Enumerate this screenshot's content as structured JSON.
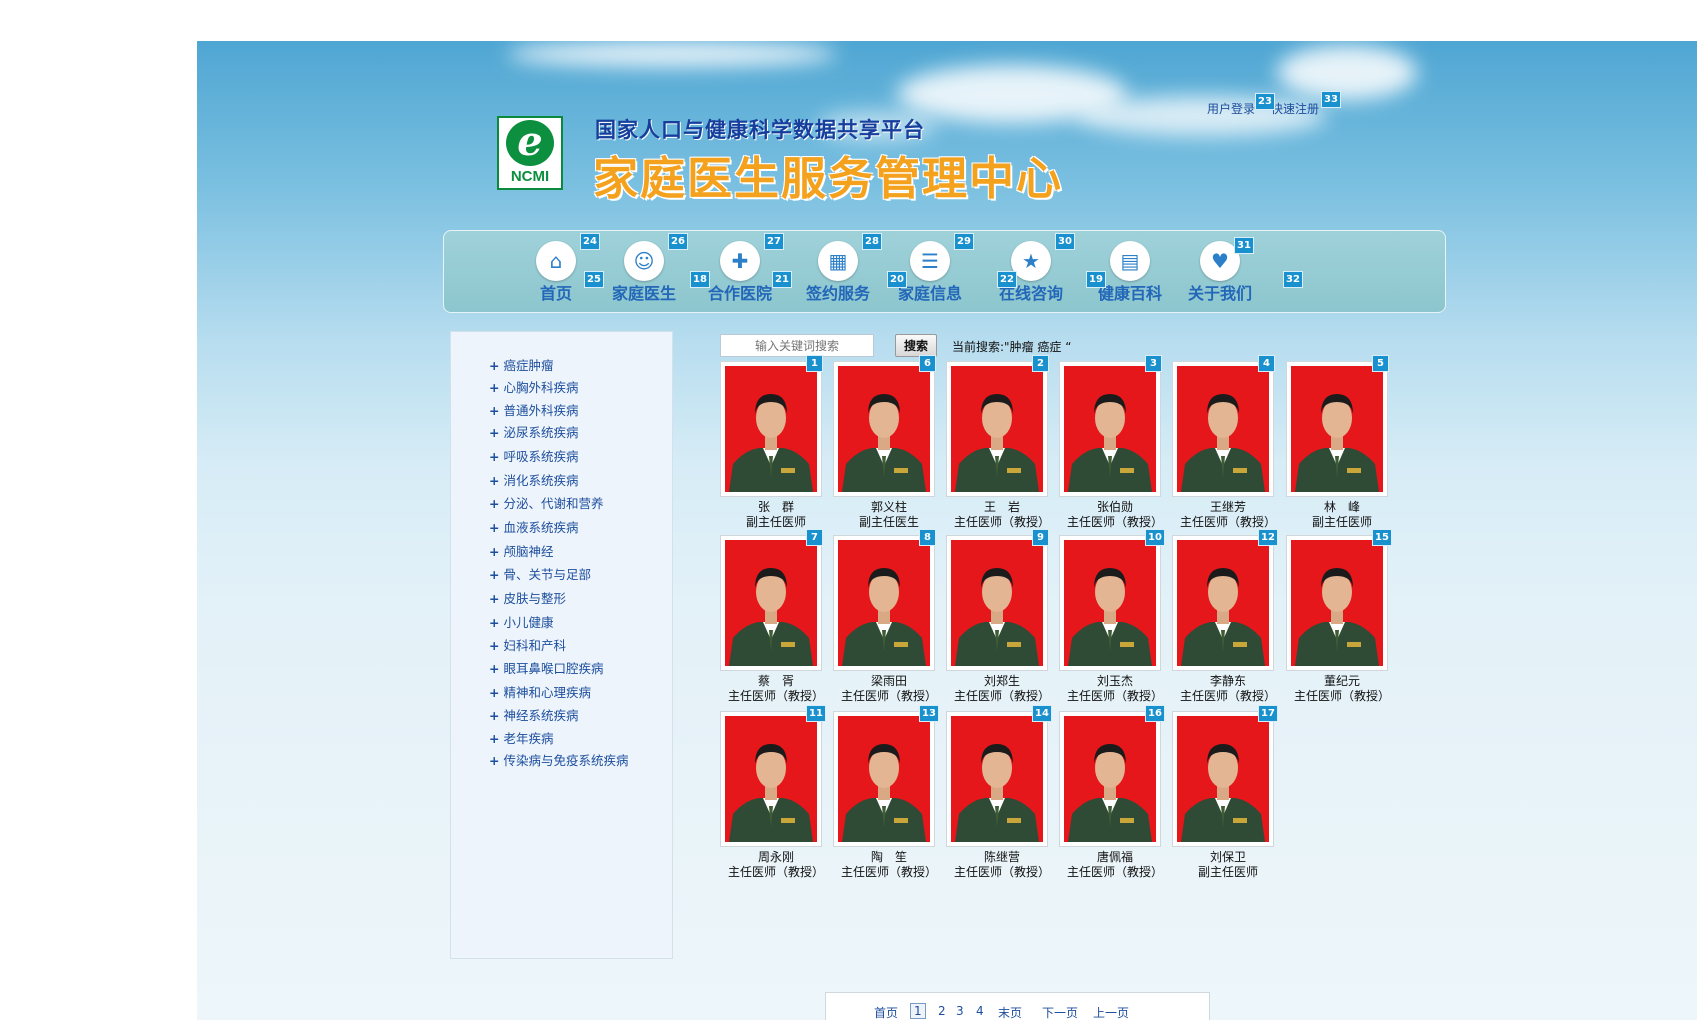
{
  "header": {
    "platform": "国家人口与健康科学数据共享平台",
    "title": "家庭医生服务管理中心",
    "logo": "NCMI",
    "login": "用户登录",
    "register": "快速注册",
    "marker_login": "23",
    "marker_register": "33"
  },
  "nav": {
    "items": [
      {
        "label": "首页",
        "icon": "home-icon",
        "marker": "24"
      },
      {
        "label": "家庭医生",
        "icon": "doctor-icon",
        "marker": "26"
      },
      {
        "label": "合作医院",
        "icon": "hospital-icon",
        "marker": "27"
      },
      {
        "label": "签约服务",
        "icon": "calendar-icon",
        "marker": "28"
      },
      {
        "label": "家庭信息",
        "icon": "person-card-icon",
        "marker": "29"
      },
      {
        "label": "在线咨询",
        "icon": "star-icon",
        "marker": "30"
      },
      {
        "label": "健康百科",
        "icon": "book-icon",
        "marker": ""
      },
      {
        "label": "关于我们",
        "icon": "handshake-icon",
        "marker": "31"
      }
    ],
    "between_markers": [
      "25",
      "18",
      "21",
      "20",
      "22",
      "19",
      "32"
    ]
  },
  "sidebar": {
    "categories": [
      "癌症肿瘤",
      "心胸外科疾病",
      "普通外科疾病",
      "泌尿系统疾病",
      "呼吸系统疾病",
      "消化系统疾病",
      "分泌、代谢和营养",
      "血液系统疾病",
      "颅脑神经",
      "骨、关节与足部",
      "皮肤与整形",
      "小儿健康",
      "妇科和产科",
      "眼耳鼻喉口腔疾病",
      "精神和心理疾病",
      "神经系统疾病",
      "老年疾病",
      "传染病与免疫系统疾病"
    ]
  },
  "search": {
    "placeholder": "输入关键词搜索",
    "button": "搜索",
    "current": "当前搜索:\"肿瘤 癌症 “"
  },
  "doctors": [
    {
      "name": "张　群",
      "title": "副主任医师",
      "marker": "1"
    },
    {
      "name": "郭义柱",
      "title": "副主任医生",
      "marker": "6"
    },
    {
      "name": "王　岩",
      "title": "主任医师（教授）",
      "marker": "2"
    },
    {
      "name": "张伯勋",
      "title": "主任医师（教授）",
      "marker": "3"
    },
    {
      "name": "王继芳",
      "title": "主任医师（教授）",
      "marker": "4"
    },
    {
      "name": "林　峰",
      "title": "副主任医师",
      "marker": "5"
    },
    {
      "name": "蔡　胥",
      "title": "主任医师（教授）",
      "marker": "7"
    },
    {
      "name": "梁雨田",
      "title": "主任医师（教授）",
      "marker": "8"
    },
    {
      "name": "刘郑生",
      "title": "主任医师（教授）",
      "marker": "9"
    },
    {
      "name": "刘玉杰",
      "title": "主任医师（教授）",
      "marker": "10"
    },
    {
      "name": "李静东",
      "title": "主任医师（教授）",
      "marker": "12"
    },
    {
      "name": "董纪元",
      "title": "主任医师（教授）",
      "marker": "15"
    },
    {
      "name": "周永刚",
      "title": "主任医师（教授）",
      "marker": "11"
    },
    {
      "name": "陶　笙",
      "title": "主任医师（教授）",
      "marker": "13"
    },
    {
      "name": "陈继营",
      "title": "主任医师（教授）",
      "marker": "14"
    },
    {
      "name": "唐佩福",
      "title": "主任医师（教授）",
      "marker": "16"
    },
    {
      "name": "刘保卫",
      "title": "副主任医师",
      "marker": "17"
    }
  ],
  "pagination": {
    "first": "首页",
    "pages": [
      "1",
      "2",
      "3",
      "4"
    ],
    "current": "1",
    "last": "末页",
    "next": "下一页",
    "prev": "上一页"
  },
  "colors": {
    "brand_green": "#0c8f3e",
    "title_orange": "#f4a11d",
    "link_blue": "#1d4e9e",
    "marker_blue": "#1a91cf"
  }
}
